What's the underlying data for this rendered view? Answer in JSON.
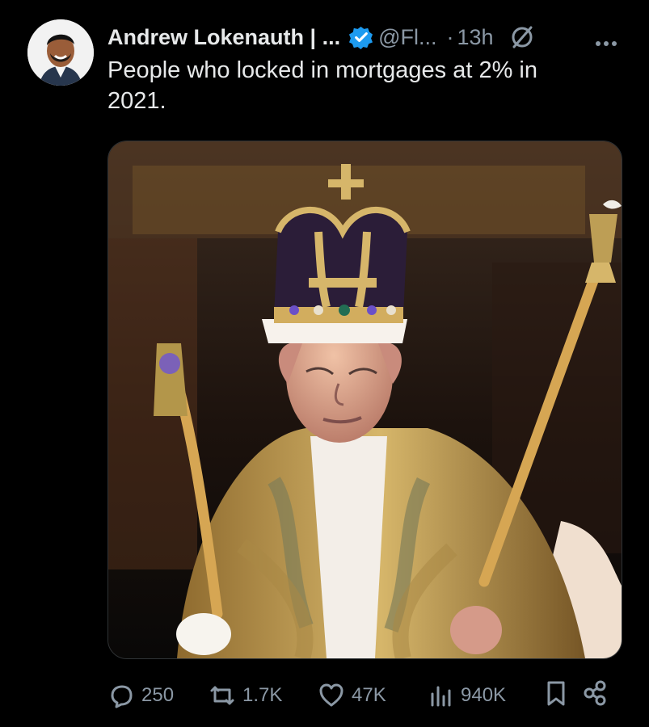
{
  "tweet": {
    "author_name": "Andrew Lokenauth | ...",
    "handle": "@Fl...",
    "separator": "·",
    "time": "13h",
    "text": "People who locked in mortgages at 2% in\n2021."
  },
  "engagement": {
    "replies": "250",
    "reposts": "1.7K",
    "likes": "47K",
    "views": "940K"
  },
  "icons": [
    "verified-icon",
    "grok-icon",
    "more-icon",
    "reply-icon",
    "repost-icon",
    "like-icon",
    "views-icon",
    "bookmark-icon",
    "share-icon"
  ],
  "colors": {
    "background": "#000000",
    "text": "#e7e9ea",
    "muted": "#8b98a5",
    "verified": "#1d9bf0"
  }
}
